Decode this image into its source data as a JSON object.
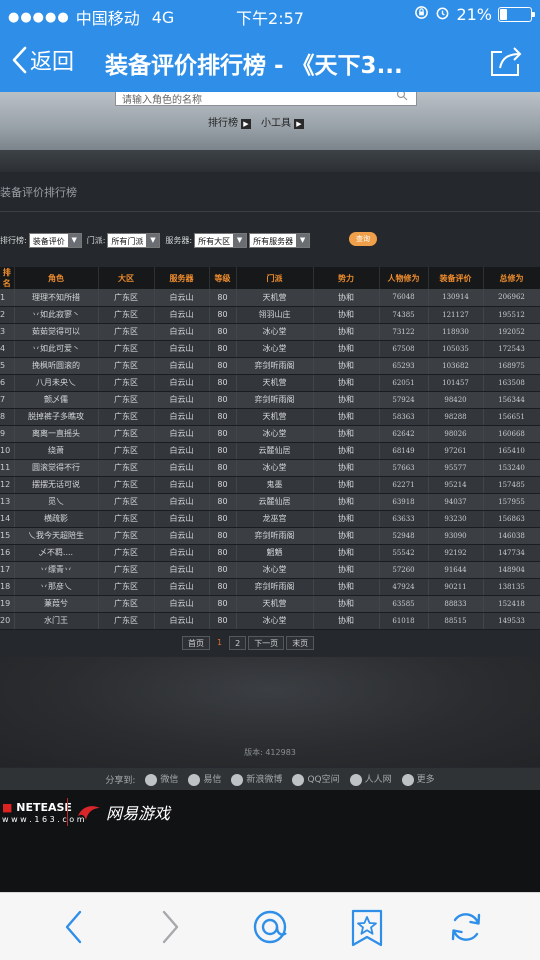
{
  "status_bar": {
    "carrier": "中国移动",
    "network": "4G",
    "time": "下午2:57",
    "battery": "21%"
  },
  "nav": {
    "back_label": "返回",
    "title": "装备评价排行榜 - 《天下3..."
  },
  "page": {
    "search_placeholder": "请输入角色的名称",
    "links": [
      "排行榜",
      "小工具"
    ],
    "section_title": "装备评价排行榜",
    "filters": {
      "rank_label": "排行榜:",
      "rank_value": "装备评价",
      "school_label": "门派:",
      "school_value": "所有门派",
      "server_label": "服务器:",
      "region_value": "所有大区",
      "server_value": "所有服务器",
      "query_label": "查询"
    },
    "table": {
      "headers": [
        "排名",
        "角色",
        "大区",
        "服务器",
        "等级",
        "门派",
        "势力",
        "人物修为",
        "装备评价",
        "总修为"
      ],
      "rows": [
        [
          "1",
          "理理不知所措",
          "广东区",
          "白云山",
          "80",
          "天机营",
          "协和",
          "76048",
          "130914",
          "206962"
        ],
        [
          "2",
          "丷如此寂寥丶",
          "广东区",
          "白云山",
          "80",
          "翎羽山庄",
          "协和",
          "74385",
          "121127",
          "195512"
        ],
        [
          "3",
          "茹茹觉得可以",
          "广东区",
          "白云山",
          "80",
          "冰心堂",
          "协和",
          "73122",
          "118930",
          "192052"
        ],
        [
          "4",
          "丷如此可爱丶",
          "广东区",
          "白云山",
          "80",
          "冰心堂",
          "协和",
          "67508",
          "105035",
          "172543"
        ],
        [
          "5",
          "挽枫听圆滚的",
          "广东区",
          "白云山",
          "80",
          "弈剑听雨阁",
          "协和",
          "65293",
          "103682",
          "168975"
        ],
        [
          "6",
          "八月未央乀",
          "广东区",
          "白云山",
          "80",
          "天机营",
          "协和",
          "62051",
          "101457",
          "163508"
        ],
        [
          "7",
          "颤乄儒",
          "广东区",
          "白云山",
          "80",
          "弈剑听雨阁",
          "协和",
          "57924",
          "98420",
          "156344"
        ],
        [
          "8",
          "脱掉裤子多瞧攻",
          "广东区",
          "白云山",
          "80",
          "天机营",
          "协和",
          "58363",
          "98288",
          "156651"
        ],
        [
          "9",
          "离离一直摇头",
          "广东区",
          "白云山",
          "80",
          "冰心堂",
          "协和",
          "62642",
          "98026",
          "160668"
        ],
        [
          "10",
          "绕萧",
          "广东区",
          "白云山",
          "80",
          "云麓仙居",
          "协和",
          "68149",
          "97261",
          "165410"
        ],
        [
          "11",
          "圆滚觉得不行",
          "广东区",
          "白云山",
          "80",
          "冰心堂",
          "协和",
          "57663",
          "95577",
          "153240"
        ],
        [
          "12",
          "摆摆无话可说",
          "广东区",
          "白云山",
          "80",
          "鬼墨",
          "协和",
          "62271",
          "95214",
          "157485"
        ],
        [
          "13",
          "觅乀",
          "广东区",
          "白云山",
          "80",
          "云麓仙居",
          "协和",
          "63918",
          "94037",
          "157955"
        ],
        [
          "14",
          "横疏影",
          "广东区",
          "白云山",
          "80",
          "龙巫宫",
          "协和",
          "63633",
          "93230",
          "156863"
        ],
        [
          "15",
          "乀我今天超陪生",
          "广东区",
          "白云山",
          "80",
          "弈剑听雨阁",
          "协和",
          "52948",
          "93090",
          "146038"
        ],
        [
          "16",
          "乄不羁....",
          "广东区",
          "白云山",
          "80",
          "魍魉",
          "协和",
          "55542",
          "92192",
          "147734"
        ],
        [
          "17",
          "丷缥青丷",
          "广东区",
          "白云山",
          "80",
          "冰心堂",
          "协和",
          "57260",
          "91644",
          "148904"
        ],
        [
          "18",
          "丷那彦乀",
          "广东区",
          "白云山",
          "80",
          "弈剑听雨阁",
          "协和",
          "47924",
          "90211",
          "138135"
        ],
        [
          "19",
          "蒹葭兮",
          "广东区",
          "白云山",
          "80",
          "天机营",
          "协和",
          "63585",
          "88833",
          "152418"
        ],
        [
          "20",
          "水门王",
          "广东区",
          "白云山",
          "80",
          "冰心堂",
          "协和",
          "61018",
          "88515",
          "149533"
        ]
      ]
    },
    "pager": [
      "首页",
      "1",
      "2",
      "下一页",
      "末页"
    ],
    "version": "版本: 412983",
    "share": {
      "label": "分享到:",
      "items": [
        "微信",
        "易信",
        "新浪微博",
        "QQ空间",
        "人人网",
        "更多"
      ]
    },
    "footer": {
      "logo1": "NETEASE",
      "logo1_sub": "w w w . 1 6 3 . c o m",
      "logo2": "网易游戏"
    }
  },
  "colors": {
    "brand_blue": "#2f8fe8",
    "header_orange": "#ee8c2c",
    "current_page": "#e06d2a"
  }
}
